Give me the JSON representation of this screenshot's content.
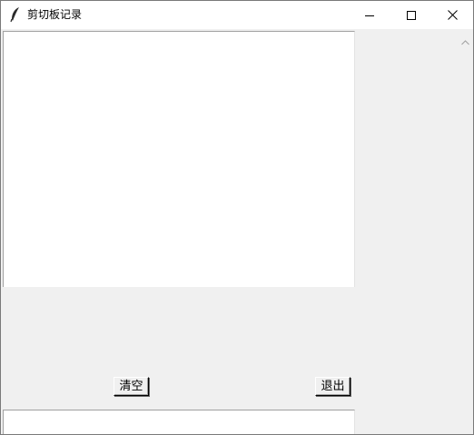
{
  "window": {
    "title": "剪切板记录",
    "icon": "feather-icon"
  },
  "controls": {
    "minimize_icon": "minimize-icon",
    "maximize_icon": "maximize-icon",
    "close_icon": "close-icon"
  },
  "main_text": {
    "value": ""
  },
  "buttons": {
    "clear_label": "清空",
    "exit_label": "退出"
  },
  "bottom_text": {
    "value": ""
  },
  "scrollbar": {
    "up_icon": "scroll-up-arrow-icon"
  },
  "colors": {
    "background": "#f0f0f0",
    "text_area": "#ffffff",
    "titlebar": "#ffffff"
  }
}
